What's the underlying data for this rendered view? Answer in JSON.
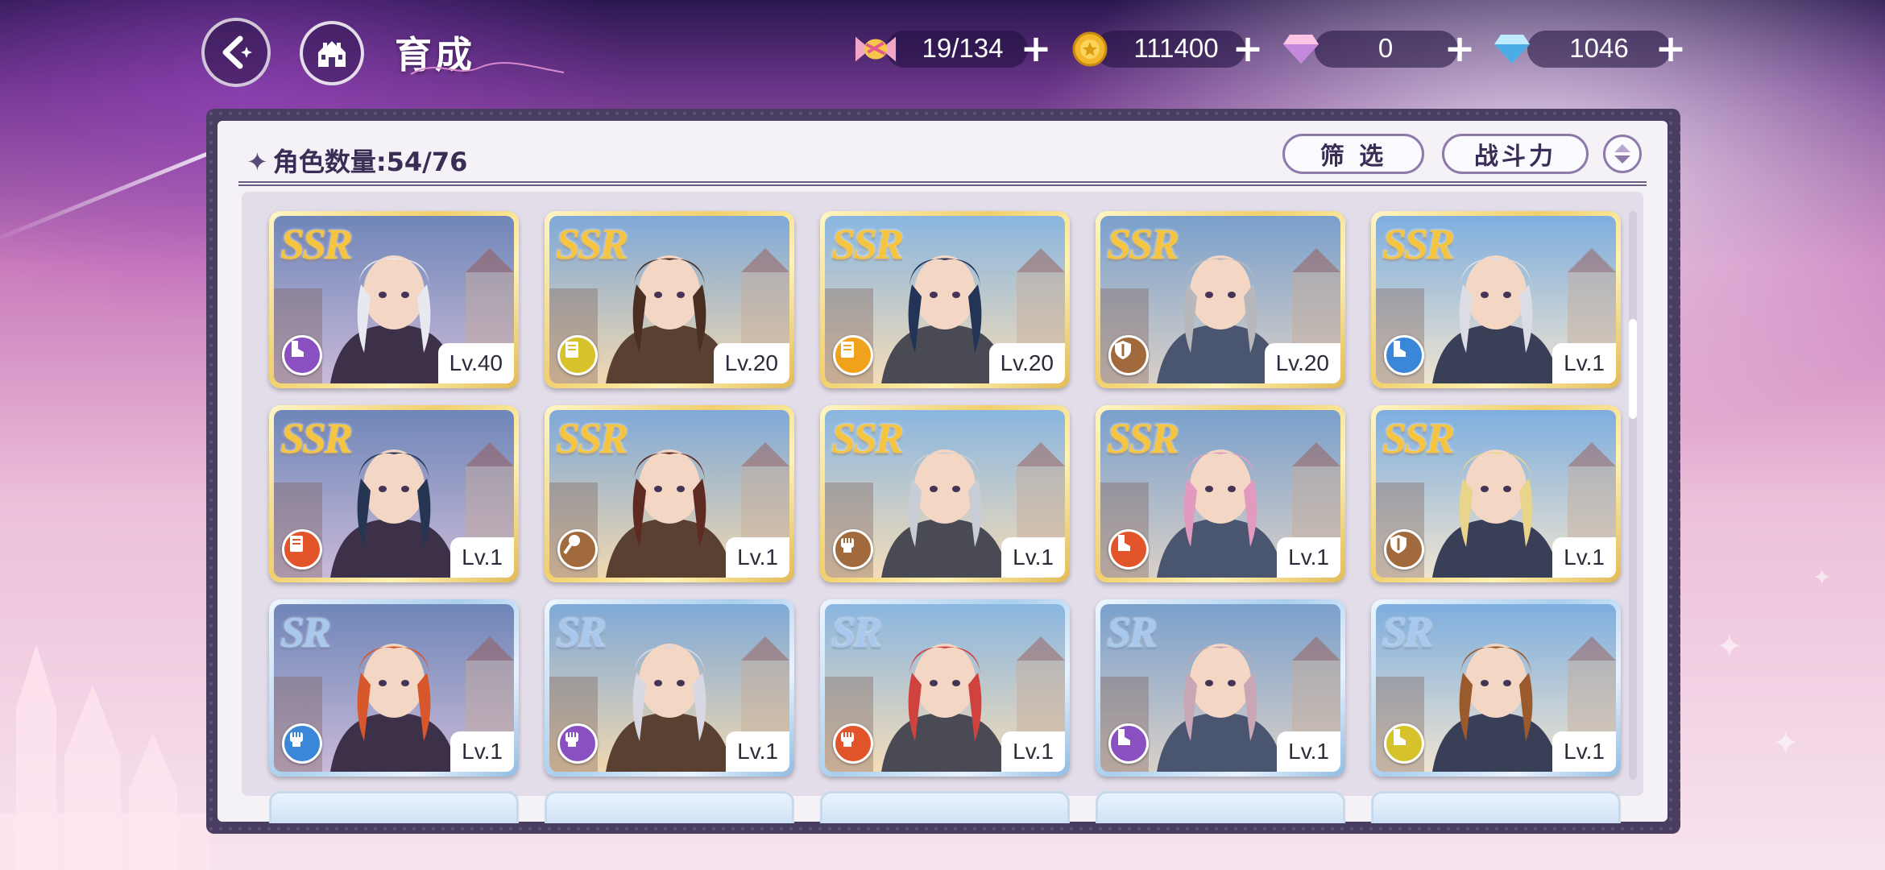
{
  "header": {
    "title": "育成",
    "resources": [
      {
        "name": "candy",
        "icon": "candy-icon",
        "value": "19/134"
      },
      {
        "name": "gold",
        "icon": "gold-coin-icon",
        "value": "111400"
      },
      {
        "name": "pink-gem",
        "icon": "pink-diamond-icon",
        "value": "0"
      },
      {
        "name": "blue-gem",
        "icon": "blue-diamond-icon",
        "value": "1046"
      }
    ]
  },
  "panel": {
    "count_label": "角色数量:54/76",
    "filter_label": "筛 选",
    "sort_label": "战斗力"
  },
  "cards": [
    {
      "rarity": "SSR",
      "level": "Lv.40",
      "class_color": "#8a4fc0",
      "class_icon": "boot-icon"
    },
    {
      "rarity": "SSR",
      "level": "Lv.20",
      "class_color": "#d6c22a",
      "class_icon": "book-icon"
    },
    {
      "rarity": "SSR",
      "level": "Lv.20",
      "class_color": "#f0a21c",
      "class_icon": "book-icon"
    },
    {
      "rarity": "SSR",
      "level": "Lv.20",
      "class_color": "#a06a3c",
      "class_icon": "shield-icon"
    },
    {
      "rarity": "SSR",
      "level": "Lv.1",
      "class_color": "#3a86d8",
      "class_icon": "boot-icon"
    },
    {
      "rarity": "SSR",
      "level": "Lv.1",
      "class_color": "#e2542a",
      "class_icon": "book-icon"
    },
    {
      "rarity": "SSR",
      "level": "Lv.1",
      "class_color": "#a06a3c",
      "class_icon": "mace-icon"
    },
    {
      "rarity": "SSR",
      "level": "Lv.1",
      "class_color": "#a06a3c",
      "class_icon": "fist-icon"
    },
    {
      "rarity": "SSR",
      "level": "Lv.1",
      "class_color": "#e2542a",
      "class_icon": "boot-icon"
    },
    {
      "rarity": "SSR",
      "level": "Lv.1",
      "class_color": "#a06a3c",
      "class_icon": "shield-icon"
    },
    {
      "rarity": "SR",
      "level": "Lv.1",
      "class_color": "#3a86d8",
      "class_icon": "fist-icon"
    },
    {
      "rarity": "SR",
      "level": "Lv.1",
      "class_color": "#8a4fc0",
      "class_icon": "fist-icon"
    },
    {
      "rarity": "SR",
      "level": "Lv.1",
      "class_color": "#e2542a",
      "class_icon": "fist-icon"
    },
    {
      "rarity": "SR",
      "level": "Lv.1",
      "class_color": "#8a4fc0",
      "class_icon": "boot-icon"
    },
    {
      "rarity": "SR",
      "level": "Lv.1",
      "class_color": "#d6c22a",
      "class_icon": "boot-icon"
    }
  ]
}
